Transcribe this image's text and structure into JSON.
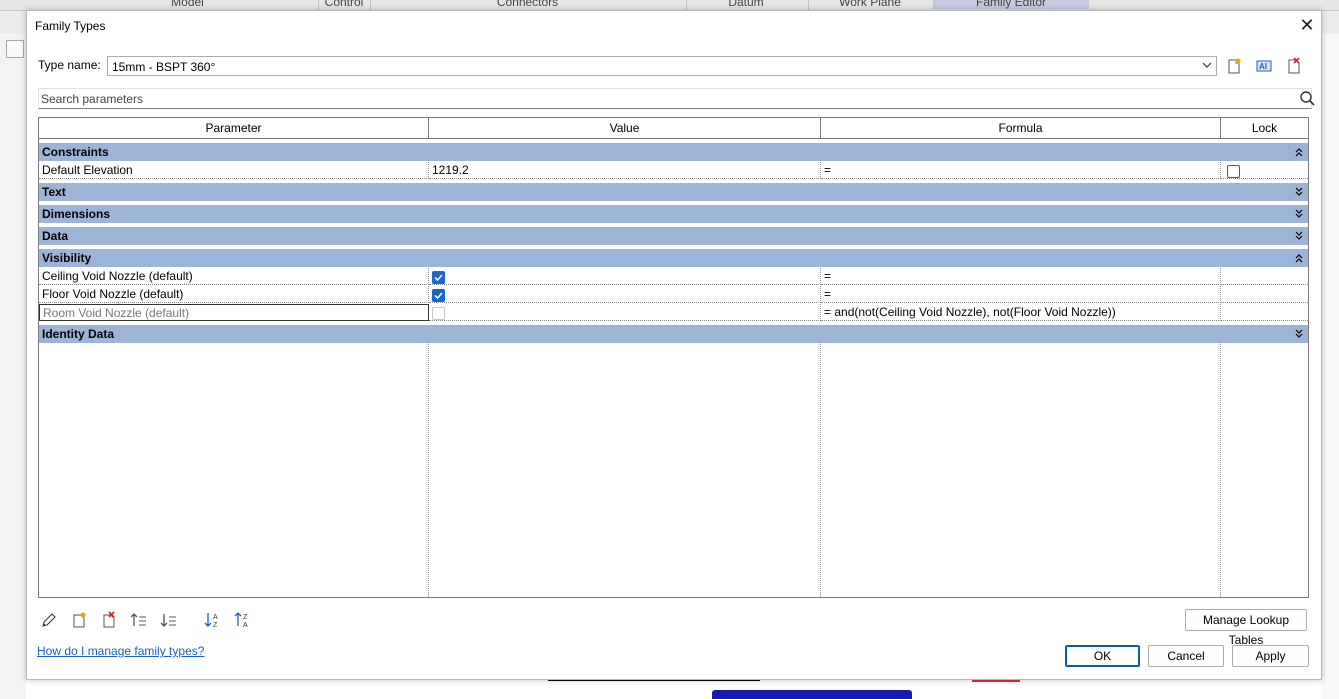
{
  "background": {
    "ribbon_tabs": [
      "Model",
      "Control",
      "Connectors",
      "Datum",
      "Work Plane",
      "Family Editor"
    ]
  },
  "dialog": {
    "title": "Family Types",
    "close_label": "✕",
    "type_name_label": "Type name:",
    "type_name_value": "15mm - BSPT 360°",
    "search_placeholder": "Search parameters"
  },
  "grid": {
    "columns": [
      "Parameter",
      "Value",
      "Formula",
      "Lock"
    ],
    "groups": [
      {
        "label": "Constraints",
        "expanded": true
      },
      {
        "label": "Text",
        "expanded": false
      },
      {
        "label": "Dimensions",
        "expanded": false
      },
      {
        "label": "Data",
        "expanded": false
      },
      {
        "label": "Visibility",
        "expanded": true
      },
      {
        "label": "Identity Data",
        "expanded": false
      }
    ],
    "rows": {
      "default_elevation": {
        "parameter": "Default Elevation",
        "value": "1219.2",
        "formula": "=",
        "lock": false
      },
      "ceiling_void": {
        "parameter": "Ceiling Void Nozzle (default)",
        "checked": true,
        "formula": "="
      },
      "floor_void": {
        "parameter": "Floor Void Nozzle (default)",
        "checked": true,
        "formula": "="
      },
      "room_void": {
        "parameter": "Room Void Nozzle (default)",
        "checked": false,
        "formula": "= and(not(Ceiling Void Nozzle), not(Floor Void Nozzle))"
      }
    }
  },
  "buttons": {
    "manage_lookup": "Manage Lookup Tables",
    "ok": "OK",
    "cancel": "Cancel",
    "apply": "Apply"
  },
  "help_link": "How do I manage family types?",
  "colors": {
    "group_header": "#9cb4d6",
    "checkbox_on": "#1768c9",
    "link": "#1a5fc9"
  },
  "icons": [
    "edit-parameter-icon",
    "new-parameter-icon",
    "delete-parameter-icon",
    "move-up-icon",
    "move-down-icon",
    "sort-ascending-icon",
    "sort-descending-icon",
    "new-type-icon",
    "rename-type-icon",
    "delete-type-icon",
    "search-icon",
    "chevron-down-icon",
    "collapse-group-icon",
    "expand-group-icon",
    "close-icon"
  ]
}
